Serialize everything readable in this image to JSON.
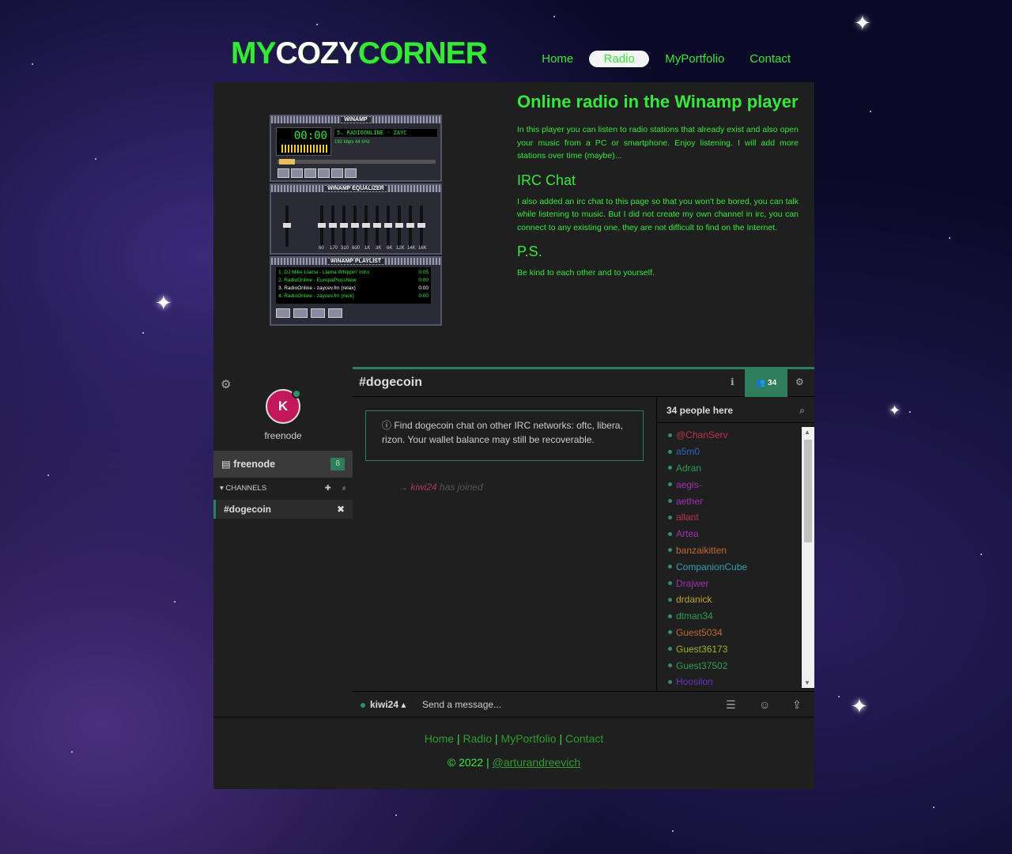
{
  "logo": {
    "part1": "MY",
    "part2": "COZY",
    "part3": "CORNER"
  },
  "nav": {
    "items": [
      "Home",
      "Radio",
      "MyPortfolio",
      "Contact"
    ],
    "active": "Radio"
  },
  "winamp": {
    "title": "WINAMP",
    "time": "00:00",
    "marquee": "5. RADIOONLINE - ZAYC",
    "kbps": "192 kbps 44 kHz",
    "eq_title": "WINAMP EQUALIZER",
    "eq_bands": [
      "60",
      "170",
      "310",
      "600",
      "1K",
      "3K",
      "6K",
      "12K",
      "14K",
      "16K"
    ],
    "playlist_title": "WINAMP PLAYLIST",
    "playlist": [
      {
        "title": "1. DJ Mike Llama - Llama Whippin' Intro",
        "len": "0:05"
      },
      {
        "title": "2. RadioOnline - EuropaPlussNew",
        "len": "0:00"
      },
      {
        "title": "3. RadioOnline - zaycev.fm (relax)",
        "len": "0:00"
      },
      {
        "title": "4. RadioOnline - zaycev.fm (rock)",
        "len": "0:00"
      }
    ]
  },
  "content": {
    "title": "Online radio in the Winamp player",
    "intro": "In this player you can listen to radio stations that already exist and also open your music from a PC or smartphone. Enjoy listening. I will add more stations over time (maybe)...",
    "irc_heading": "IRC Chat",
    "irc_text": "I also added an irc chat to this page so that you won't be bored, you can talk while listening to music. But I did not create my own channel in irc, you can connect to any existing one, they are not difficult to find on the Internet.",
    "ps_heading": "P.S.",
    "ps_text": "Be kind to each other and to yourself."
  },
  "kiwi": {
    "avatar_letter": "K",
    "network": "freenode",
    "network_badge": "8",
    "channels_label": "CHANNELS",
    "channel": "#dogecoin",
    "header_channel": "#dogecoin",
    "user_count": "34",
    "notice": "ⓘ Find dogecoin chat on other IRC networks: oftc, libera, rizon. Your wallet balance may still be recoverable.",
    "join_nick": "kiwi24",
    "join_text": "has joined",
    "people_label": "34 people here",
    "nicks": [
      {
        "name": "@ChanServ",
        "color": "#c0304a"
      },
      {
        "name": "a5m0",
        "color": "#2a63c0"
      },
      {
        "name": "Adran",
        "color": "#2e9e4e"
      },
      {
        "name": "aegis-",
        "color": "#a030b0"
      },
      {
        "name": "aether",
        "color": "#a030b0"
      },
      {
        "name": "allant",
        "color": "#c0304a"
      },
      {
        "name": "Artea",
        "color": "#a030b0"
      },
      {
        "name": "banzaikitten",
        "color": "#c06a30"
      },
      {
        "name": "CompanionCube",
        "color": "#30a0b0"
      },
      {
        "name": "Drajwer",
        "color": "#a030b0"
      },
      {
        "name": "drdanick",
        "color": "#c0a020"
      },
      {
        "name": "dtman34",
        "color": "#2e9e4e"
      },
      {
        "name": "Guest5034",
        "color": "#c06a30"
      },
      {
        "name": "Guest36173",
        "color": "#a0b020"
      },
      {
        "name": "Guest37502",
        "color": "#2e9e4e"
      },
      {
        "name": "Hoosilon",
        "color": "#6a30c0"
      }
    ],
    "my_nick": "kiwi24",
    "message_placeholder": "Send a message..."
  },
  "footer": {
    "links": [
      "Home",
      "Radio",
      "MyPortfolio",
      "Contact"
    ],
    "copyright": "© 2022 |",
    "handle": "@arturandreevich"
  }
}
